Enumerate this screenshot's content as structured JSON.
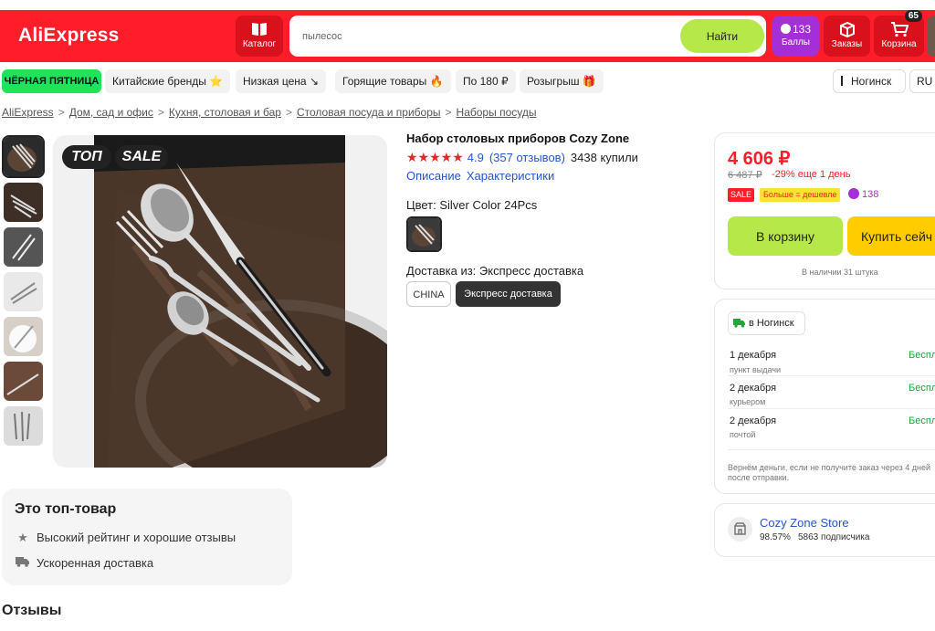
{
  "header": {
    "logo": "AliExpress",
    "catalog_label": "Каталог",
    "search_placeholder": "пылесос",
    "search_button": "Найти",
    "points_count": "133",
    "points_label": "Баллы",
    "orders_label": "Заказы",
    "cart_label": "Корзина",
    "cart_count": "65",
    "colors": {
      "brand": "#ff1d2a",
      "accent_green": "#b6e84a",
      "points_purple": "#a52fd6"
    }
  },
  "promo": {
    "items": [
      "ЧЁРНАЯ ПЯТНИЦА",
      "Китайские бренды ⭐",
      "Низкая цена ↘",
      "Горящие товары 🔥",
      "По 180 ₽",
      "Розыгрыш 🎁"
    ],
    "location": "Ногинск",
    "language": "RU"
  },
  "breadcrumbs": [
    "AliExpress",
    "Дом, сад и офис",
    "Кухня, столовая и бар",
    "Столовая посуда и приборы",
    "Наборы посуды"
  ],
  "gallery": {
    "badges": [
      "ТОП",
      "SALE"
    ],
    "thumb_count": 7
  },
  "product": {
    "title": "Набор столовых приборов Cozy Zone",
    "stars": "★★★★★",
    "rating": "4.9",
    "reviews": "(357 отзывов)",
    "bought": "3438 купили",
    "links": [
      "Описание",
      "Характеристики"
    ],
    "color_label": "Цвет: Silver Color 24Pcs",
    "shipping_label": "Доставка из: Экспресс доставка",
    "shipping_options": [
      "CHINA",
      "Экспресс доставка"
    ]
  },
  "buybox": {
    "price": "4 606 ₽",
    "old_price": "6 487 ₽",
    "discount": "-29% еще 1 день",
    "sale_tag": "SALE",
    "more_tag": "Больше = дешевле",
    "bonus": "138",
    "cart_button": "В корзину",
    "buy_button": "Купить сейч",
    "stock": "В наличии 31 штука"
  },
  "delivery": {
    "location": "в Ногинск",
    "options": [
      {
        "date": "1 декабря",
        "method": "пункт выдачи",
        "price": "Беспл"
      },
      {
        "date": "2 декабря",
        "method": "курьером",
        "price": "Беспл"
      },
      {
        "date": "2 декабря",
        "method": "почтой",
        "price": "Беспл"
      }
    ],
    "refund": "Вернём деньги, если не получите заказ через 4 дней после отправки."
  },
  "store": {
    "name": "Cozy Zone Store",
    "rating": "98.57%",
    "subscribers": "5863 подписчика"
  },
  "top_product": {
    "title": "Это топ-товар",
    "features": [
      {
        "icon": "star-icon",
        "text": "Высокий рейтинг и хорошие отзывы"
      },
      {
        "icon": "truck-icon",
        "text": "Ускоренная доставка"
      }
    ]
  },
  "reviews_heading": "Отзывы"
}
